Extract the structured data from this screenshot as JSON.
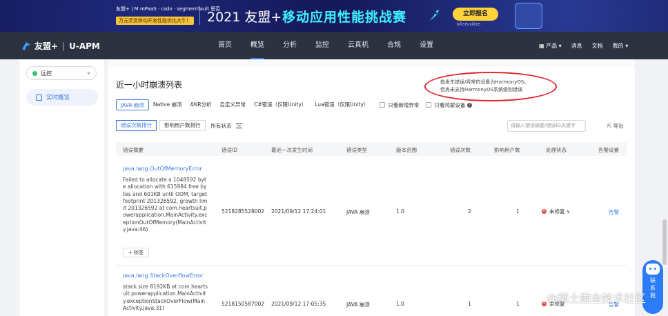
{
  "banner": {
    "logos": "友盟+ | M mPaaS · csdn · segmentfault 思否",
    "sub": "万元奖赏移动开发性能优化大牛！",
    "year": "2021 友盟+",
    "title": "移动应用性能挑战赛",
    "cta": "立即报名",
    "date": "6月3日-9月3日"
  },
  "nav": {
    "brand": "友盟+",
    "product": "U-APM",
    "items": [
      "首页",
      "概览",
      "分析",
      "监控",
      "云真机",
      "合规",
      "设置"
    ],
    "active_index": 1,
    "right": {
      "product": "产品",
      "messages": "消息",
      "docs": "文档",
      "mine": "我的"
    }
  },
  "sidebar": {
    "app_select": "远控",
    "items": [
      {
        "label": "实时概览"
      }
    ]
  },
  "main": {
    "title": "近一小时崩溃列表",
    "note": "指发生错误/异常的设备为HarmonyOS，但尚未支持HarmonyOS系统级别错误",
    "tabs": [
      "JAVA 崩溃",
      "Native 崩溃",
      "ANR分析",
      "自定义异常",
      "C#错误（仅限Unity）",
      "Lua错误（仅限Unity）"
    ],
    "active_tab": 0,
    "checks": [
      "只看新增异常",
      "只看鸿蒙设备"
    ],
    "sorts": [
      "错误次数排行",
      "影响用户数排行"
    ],
    "filter": "所有状态",
    "search_placeholder": "请输入错误摘要/错误ID关键字",
    "export": "导出",
    "columns": [
      "错误摘要",
      "错误ID",
      "最近一次发生时间",
      "错误类型",
      "版本范围",
      "错误次数",
      "影响用户数",
      "处理状态",
      "告警设置"
    ],
    "rows": [
      {
        "title": "java.lang.OutOfMemoryError",
        "desc": "Failed to allocate a 1048592 byte allocation with 615984 free bytes and 601KB until OOM, target footprint 201326592, growth limit 201326592 at com.heartsuit.powerapplication.MainActivity.exceptionOutOfMemory(MainActivity.java:46)",
        "id": "5218285528002",
        "time": "2021/09/12 17:24:01",
        "type": "JAVA 崩溃",
        "version": "1.0",
        "count": "2",
        "users": "1",
        "status": "未修复",
        "alarm": "告警",
        "tag": "+ 标签"
      },
      {
        "title": "java.lang.StackOverflowError",
        "desc": "stack size 8192KB at com.heartsuit.powerapplication.MainActivity.exceptionStackOverFlow(MainActivity.java:31)",
        "id": "5218150587002",
        "time": "2021/09/12 17:05:35",
        "type": "JAVA 崩溃",
        "version": "1.0",
        "count": "1",
        "users": "1",
        "status": "未修复",
        "alarm": "告警"
      }
    ]
  },
  "helper": {
    "line1": "联",
    "line2": "系",
    "line3": "我"
  },
  "watermark": "@稀土掘金技术社区",
  "colors": {
    "accent": "#3a78e0",
    "navbar": "#2c3240",
    "banner": "#15195a",
    "highlight": "#e0262b"
  }
}
